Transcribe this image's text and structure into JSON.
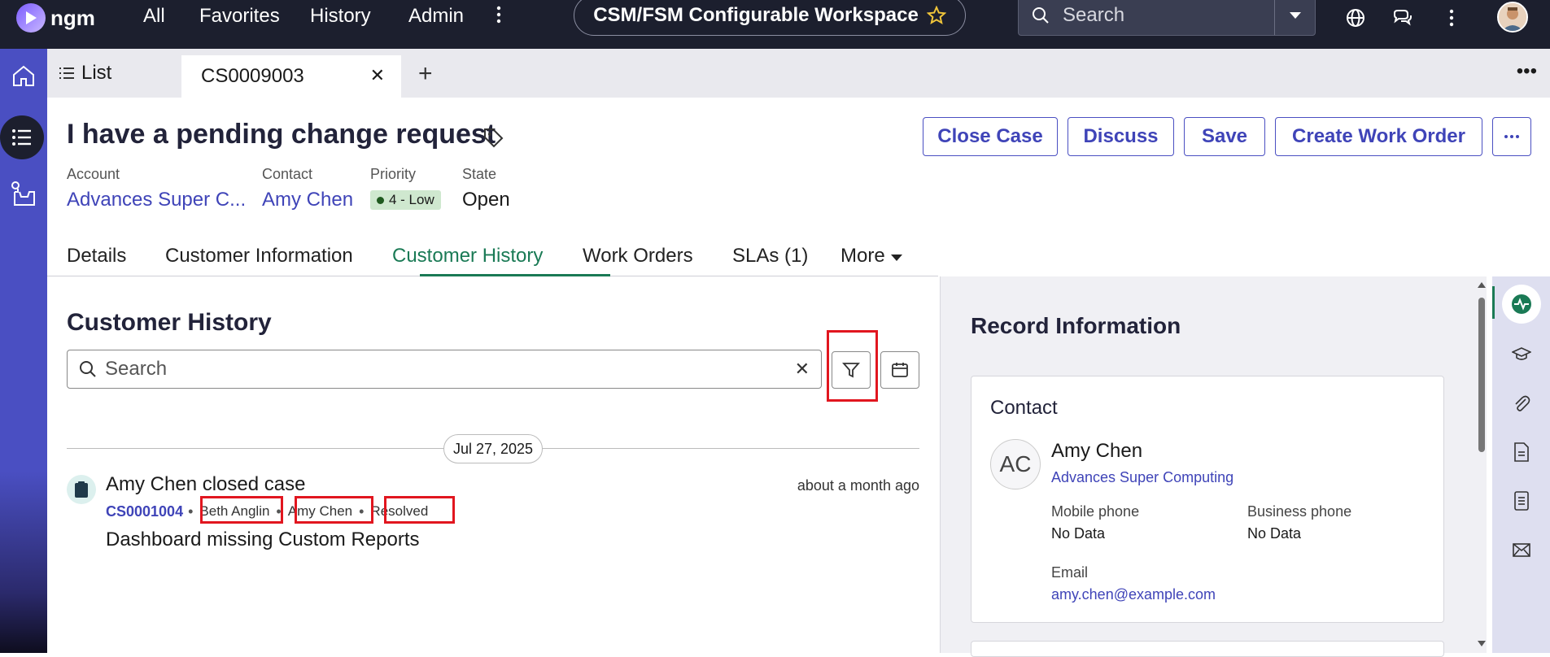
{
  "topbar": {
    "logo_text": "ngm",
    "nav": [
      "All",
      "Favorites",
      "History",
      "Admin"
    ],
    "workspace_title": "CSM/FSM Configurable Workspace",
    "search_placeholder": "Search"
  },
  "tabs": {
    "list_label": "List",
    "record_label": "CS0009003"
  },
  "record": {
    "title": "I have a pending change request",
    "buttons": [
      "Close Case",
      "Discuss",
      "Save",
      "Create Work Order"
    ],
    "meta": {
      "account_label": "Account",
      "account_value": "Advances Super C...",
      "contact_label": "Contact",
      "contact_value": "Amy Chen",
      "priority_label": "Priority",
      "priority_value": "4 - Low",
      "state_label": "State",
      "state_value": "Open"
    }
  },
  "subtabs": [
    "Details",
    "Customer Information",
    "Customer History",
    "Work Orders",
    "SLAs (1)",
    "More"
  ],
  "history": {
    "title": "Customer History",
    "search_placeholder": "Search",
    "date": "Jul 27, 2025",
    "activity": {
      "title": "Amy Chen closed case",
      "time": "about a month ago",
      "case": "CS0001004",
      "assignee": "Beth Anglin",
      "contact": "Amy Chen",
      "state": "Resolved",
      "description": "Dashboard missing  Custom Reports"
    }
  },
  "side": {
    "title": "Record Information",
    "card_title": "Contact",
    "initials": "AC",
    "name": "Amy Chen",
    "company": "Advances Super Computing",
    "mobile_label": "Mobile phone",
    "mobile_value": "No Data",
    "business_label": "Business phone",
    "business_value": "No Data",
    "email_label": "Email",
    "email_value": "amy.chen@example.com"
  },
  "colors": {
    "accent": "#3f44b8",
    "topbar": "#1c1f2e",
    "active_tab": "#1a7a55",
    "highlight": "#e1161f"
  }
}
